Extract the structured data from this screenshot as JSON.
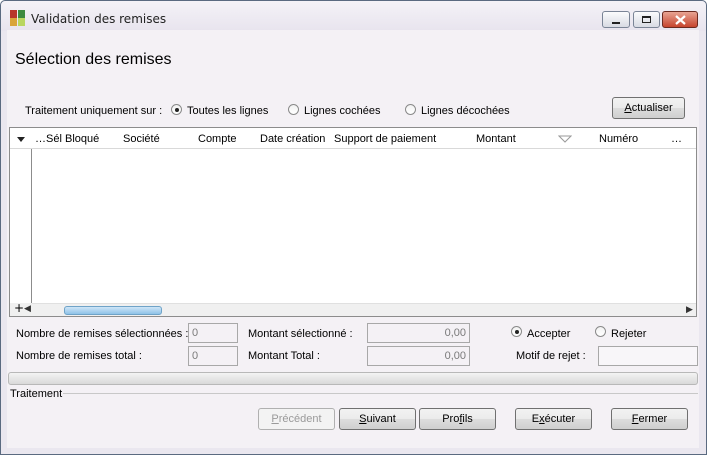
{
  "window": {
    "title": "Validation des remises",
    "controls": {
      "minimize": "minimize-icon",
      "maximize": "maximize-icon",
      "close": "close-icon"
    }
  },
  "page": {
    "heading": "Sélection des remises"
  },
  "filter": {
    "label": "Traitement uniquement sur :",
    "options": [
      {
        "label": "Toutes les lignes",
        "selected": true
      },
      {
        "label": "Lignes cochées",
        "selected": false
      },
      {
        "label": "Lignes décochées",
        "selected": false
      }
    ],
    "refresh_button": {
      "label_first": "A",
      "label_rest": "ctualiser"
    }
  },
  "grid": {
    "columns": [
      "…Sél",
      "Bloqué",
      "Société",
      "Compte",
      "Date création",
      "Support de paiement",
      "Montant",
      "Numéro",
      "…"
    ],
    "rows": [],
    "sort_column": "Montant",
    "add_row_glyph": "+"
  },
  "summary": {
    "selected_count_label": "Nombre de remises sélectionnées :",
    "selected_count": "0",
    "total_count_label": "Nombre de remises total :",
    "total_count": "0",
    "selected_amount_label": "Montant sélectionné :",
    "selected_amount": "0,00",
    "total_amount_label": "Montant Total :",
    "total_amount": "0,00",
    "decision": [
      {
        "label": "Accepter",
        "selected": true
      },
      {
        "label": "Rejeter",
        "selected": false
      }
    ],
    "reject_reason_label": "Motif de rejet :",
    "reject_reason": ""
  },
  "processing": {
    "label": "Traitement",
    "progress_percent": 0
  },
  "footer_buttons": {
    "previous": {
      "label_first": "P",
      "label_rest": "récédent",
      "enabled": false
    },
    "next": {
      "label_first": "S",
      "label_rest": "uivant",
      "enabled": true
    },
    "profiles": {
      "label_before": "Pro",
      "label_mid": "f",
      "label_after": "ils",
      "enabled": true
    },
    "execute": {
      "label_before": "E",
      "label_mid": "x",
      "label_after": "écuter",
      "enabled": true
    },
    "close": {
      "label_first": "F",
      "label_rest": "ermer",
      "enabled": true
    }
  },
  "colors": {
    "accent": "#8fc3e8",
    "window_border": "#5a6a80",
    "close_red": "#c6442e",
    "disabled_text": "#9a9a9a"
  }
}
